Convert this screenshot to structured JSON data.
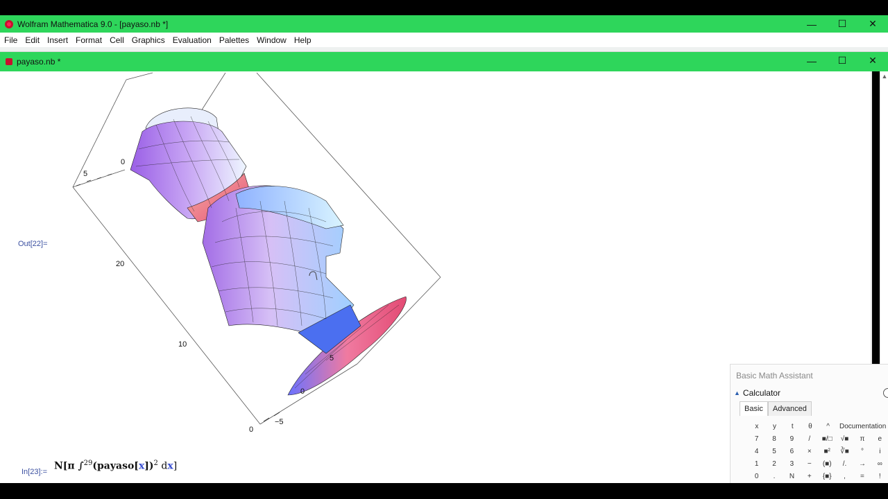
{
  "window": {
    "title": "Wolfram Mathematica 9.0 - [payaso.nb *]"
  },
  "window_controls": {
    "minimize": "—",
    "maximize": "☐",
    "close": "✕"
  },
  "menu": [
    "File",
    "Edit",
    "Insert",
    "Format",
    "Cell",
    "Graphics",
    "Evaluation",
    "Palettes",
    "Window",
    "Help"
  ],
  "notebook": {
    "title": "payaso.nb *"
  },
  "cells": {
    "out_label": "Out[22]=",
    "in_label": "In[23]:=",
    "input": {
      "prefix": "N[π ∫",
      "upper_limit": "29",
      "body_open": "(payaso[",
      "var": "x",
      "body_close": "])",
      "exponent": "2",
      "diff": " d",
      "diff_var": "x",
      "suffix": "]"
    }
  },
  "plot": {
    "axis_labels": [
      "0",
      "5",
      "20",
      "10",
      "0",
      "−5",
      "5",
      "0"
    ],
    "surface_colors": {
      "purple": "#a872e8",
      "blue": "#7cb6ff",
      "pink": "#f0728a",
      "cyan": "#cfeefc"
    }
  },
  "assistant": {
    "title": "Basic Math Assistant",
    "section": "Calculator",
    "tabs": [
      "Basic",
      "Advanced"
    ],
    "documentation": "Documentation",
    "keys": [
      [
        "x",
        "y",
        "t",
        "θ",
        "^"
      ],
      [
        "7",
        "8",
        "9",
        "/",
        "■/□"
      ],
      [
        "4",
        "5",
        "6",
        "×",
        "■²"
      ],
      [
        "1",
        "2",
        "3",
        "−",
        "(■)"
      ],
      [
        "0",
        ".",
        "N",
        "+",
        "{■}"
      ]
    ],
    "keys_right": [
      [
        "√■",
        "π",
        "e"
      ],
      [
        "∛■",
        "°",
        "i"
      ],
      [
        "/.",
        "→",
        "∞"
      ],
      [
        ",",
        "=",
        "!"
      ]
    ]
  }
}
